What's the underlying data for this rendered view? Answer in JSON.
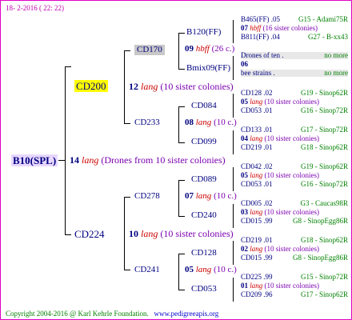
{
  "header": {
    "date": "18-  2-2016 ( 22: 22)"
  },
  "root": {
    "id": "B10(SPL)",
    "colonies": "14",
    "lang": "lang",
    "note": "(Drones from 10 sister colonies)"
  },
  "gen1": {
    "top": {
      "id": "CD200",
      "num": "12",
      "lang": "lang",
      "sis": "(10 sister colonies)"
    },
    "bot": {
      "id": "CD224",
      "num": "10",
      "lang": "lang",
      "sis": "(10 sister colonies)"
    }
  },
  "gen2": [
    {
      "id": "CD170",
      "num": "09",
      "lang": "hbff",
      "sis": "(26 c.)"
    },
    {
      "id": "CD233",
      "num": "08",
      "lang": "lang",
      "sis": "(10 c.)"
    },
    {
      "id": "CD278",
      "num": "07",
      "lang": "lang",
      "sis": "(10 c.)"
    },
    {
      "id": "CD241",
      "num": "05",
      "lang": "lang",
      "sis": "(10 c.)"
    }
  ],
  "gen3": [
    {
      "id": "B120(FF)"
    },
    {
      "id": "Bmix09(FF)"
    },
    {
      "id": "CD084"
    },
    {
      "id": "CD099"
    },
    {
      "id": "CD089"
    },
    {
      "id": "CD240"
    },
    {
      "id": "CD128"
    },
    {
      "id": "CD053"
    }
  ],
  "gen4": [
    {
      "top": "B465(FF)",
      "topyr": ".05",
      "topcode": "G15 - Adami75R",
      "num": "07",
      "lang": "hbff",
      "sis": "(16 sister colonies)",
      "bot": "B811(FF)",
      "botyr": ".04",
      "botcode": "G27 - B-xx43"
    },
    {
      "top": "Drones of ten",
      "topyr": ".",
      "topcode": "no more",
      "num": "06",
      "lang": "",
      "sis": "",
      "bot": "bee strains",
      "botyr": ".",
      "botcode": "no more"
    },
    {
      "top": "CD128",
      "topyr": ".02",
      "topcode": "G19 - Sinop62R",
      "num": "05",
      "lang": "lang",
      "sis": "(10 sister colonies)",
      "bot": "CD053",
      "botyr": ".01",
      "botcode": "G16 - Sinop72R"
    },
    {
      "top": "CD133",
      "topyr": ".01",
      "topcode": "G17 - Sinop72R",
      "num": "04",
      "lang": "lang",
      "sis": "(10 sister colonies)",
      "bot": "CD219",
      "botyr": ".01",
      "botcode": "G18 - Sinop62R"
    },
    {
      "top": "CD042",
      "topyr": ".02",
      "topcode": "G19 - Sinop62R",
      "num": "05",
      "lang": "lang",
      "sis": "(10 sister colonies)",
      "bot": "CD053",
      "botyr": ".01",
      "botcode": "G16 - Sinop72R"
    },
    {
      "top": "CD005",
      "topyr": ".02",
      "topcode": "G3 - Caucas98R",
      "num": "03",
      "lang": "lang",
      "sis": "(10 sister colonies)",
      "bot": "CD015",
      "botyr": ".99",
      "botcode": "G8 - SinopEgg86R"
    },
    {
      "top": "CD219",
      "topyr": ".01",
      "topcode": "G18 - Sinop62R",
      "num": "02",
      "lang": "lang",
      "sis": "(10 sister colonies)",
      "bot": "CD015",
      "botyr": ".99",
      "botcode": "G8 - SinopEgg86R"
    },
    {
      "top": "CD225",
      "topyr": ".99",
      "topcode": "G15 - Sinop72R",
      "num": "01",
      "lang": "lang",
      "sis": "(10 sister colonies)",
      "bot": "CD209",
      "botyr": ".96",
      "botcode": "G17 - Sinop62R"
    }
  ],
  "footer": {
    "copyright": "Copyright 2004-2016 @ Karl Kehrle Foundation.",
    "site": "www.pedigreeapis.org"
  },
  "colors": {
    "border": "#e000c8",
    "text": "#000080",
    "lang": "#cc0000",
    "sister": "#7b00b0",
    "code": "#008000",
    "highlight": "#ffff00",
    "root_bg": "#e8d8ff"
  }
}
